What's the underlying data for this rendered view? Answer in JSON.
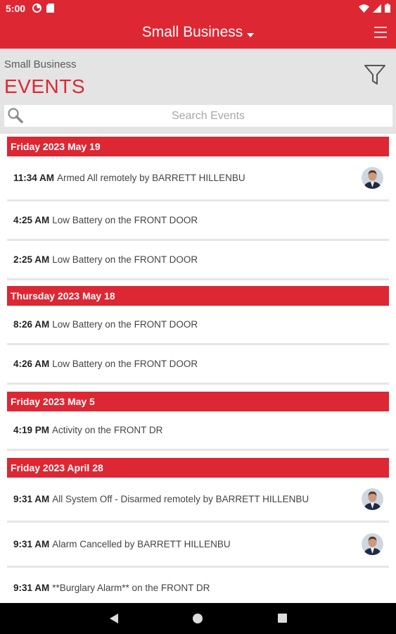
{
  "status_bar": {
    "time": "5:00"
  },
  "app_bar": {
    "title": "Small Business",
    "dropdown_icon": "caret-down-icon",
    "menu_icon": "hamburger-menu-icon"
  },
  "header": {
    "subtitle": "Small Business",
    "title": "EVENTS",
    "filter_icon": "funnel-filter-icon"
  },
  "search": {
    "placeholder": "Search Events",
    "value": ""
  },
  "groups": [
    {
      "date": "Friday 2023 May 19",
      "events": [
        {
          "time": "11:34 AM",
          "text": "Armed All remotely by BARRETT HILLENBU",
          "avatar": true
        },
        {
          "time": "4:25 AM",
          "text": "Low Battery on the FRONT DOOR",
          "avatar": false
        },
        {
          "time": "2:25 AM",
          "text": "Low Battery on the FRONT DOOR",
          "avatar": false
        }
      ]
    },
    {
      "date": "Thursday 2023 May 18",
      "events": [
        {
          "time": "8:26 AM",
          "text": "Low Battery on the FRONT DOOR",
          "avatar": false
        },
        {
          "time": "4:26 AM",
          "text": "Low Battery on the FRONT DOOR",
          "avatar": false
        }
      ]
    },
    {
      "date": "Friday 2023 May 5",
      "events": [
        {
          "time": "4:19 PM",
          "text": "Activity on the FRONT DR",
          "avatar": false
        }
      ]
    },
    {
      "date": "Friday 2023 April 28",
      "events": [
        {
          "time": "9:31 AM",
          "text": "All System Off - Disarmed remotely by BARRETT HILLENBU",
          "avatar": true
        },
        {
          "time": "9:31 AM",
          "text": "Alarm Cancelled by BARRETT HILLENBU",
          "avatar": true
        },
        {
          "time": "9:31 AM",
          "text": "**Burglary Alarm** on the FRONT DR",
          "avatar": false
        }
      ]
    }
  ],
  "colors": {
    "brand_red": "#dd2733",
    "header_gray": "#e4e4e4",
    "divider": "#e6e6e6"
  }
}
